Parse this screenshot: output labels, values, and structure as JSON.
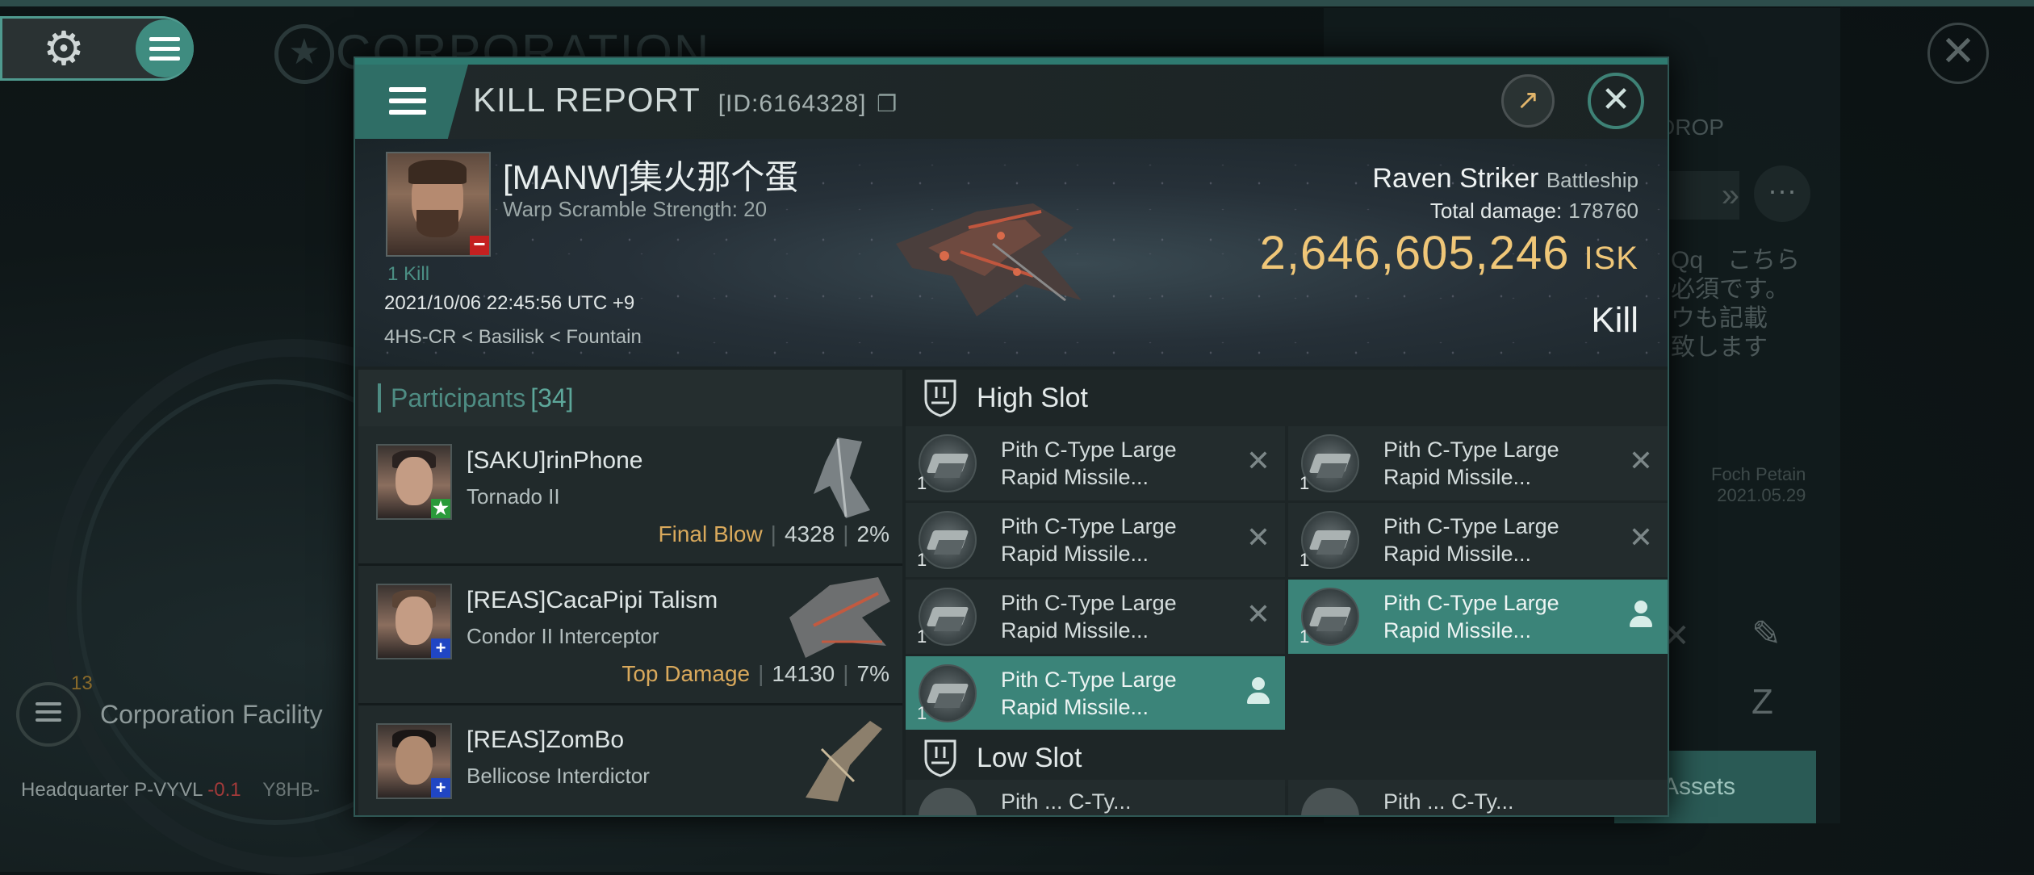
{
  "background": {
    "corp_title": "CORPORATION",
    "corp_facility_label": "Corporation Facility",
    "corp_facility_badge": "13",
    "hq_label": "Headquarter P-VYVL",
    "hq_sec": "-0.1",
    "hq_next": "Y8HB-",
    "assets_label": "Assets",
    "drop_label": "DROP",
    "jp_text_lines": [
      "Qq　こちら",
      "必須です。",
      "ウも記載",
      "致します"
    ],
    "foch_name": "Foch Petain",
    "foch_date": "2021.05.29"
  },
  "modal": {
    "title": "KILL REPORT",
    "id": "[ID:6164328]",
    "copy_icon": "❐"
  },
  "victim": {
    "name": "[MANW]集火那个蛋",
    "detail": "Warp Scramble Strength: 20",
    "kill_count": "1 Kill",
    "datetime": "2021/10/06 22:45:56 UTC +9",
    "location": "4HS-CR < Basilisk < Fountain"
  },
  "ship": {
    "name": "Raven Striker",
    "class": "Battleship",
    "total_damage_label": "Total damage:",
    "total_damage_value": "178760",
    "isk_value": "2,646,605,246",
    "isk_unit": "ISK",
    "result": "Kill"
  },
  "participants": {
    "label": "Participants",
    "count": "[34]",
    "rows": [
      {
        "name": "[SAKU]rinPhone",
        "ship": "Tornado II",
        "tag": "Final Blow",
        "damage": "4328",
        "pct": "2%",
        "badge": "★",
        "badge_color": "#2a9a3a"
      },
      {
        "name": "[REAS]CacaPipi Talism",
        "ship": "Condor II Interceptor",
        "tag": "Top Damage",
        "damage": "14130",
        "pct": "7%",
        "badge": "+",
        "badge_color": "#2046c4"
      },
      {
        "name": "[REAS]ZomBo",
        "ship": "Bellicose Interdictor",
        "tag": "",
        "damage": "",
        "pct": "",
        "badge": "+",
        "badge_color": "#2046c4"
      }
    ]
  },
  "high_slot": {
    "label": "High Slot",
    "modules": [
      {
        "line1": "Pith C-Type Large",
        "line2": "Rapid Missile...",
        "qty": "1",
        "state": "destroyed"
      },
      {
        "line1": "Pith C-Type Large",
        "line2": "Rapid Missile...",
        "qty": "1",
        "state": "destroyed"
      },
      {
        "line1": "Pith C-Type Large",
        "line2": "Rapid Missile...",
        "qty": "1",
        "state": "destroyed"
      },
      {
        "line1": "Pith C-Type Large",
        "line2": "Rapid Missile...",
        "qty": "1",
        "state": "destroyed"
      },
      {
        "line1": "Pith C-Type Large",
        "line2": "Rapid Missile...",
        "qty": "1",
        "state": "destroyed"
      },
      {
        "line1": "Pith C-Type Large",
        "line2": "Rapid Missile...",
        "qty": "1",
        "state": "dropped"
      },
      {
        "line1": "Pith C-Type Large",
        "line2": "Rapid Missile...",
        "qty": "1",
        "state": "dropped"
      }
    ]
  },
  "low_slot": {
    "label": "Low Slot",
    "peek": [
      "Pith ... C-Ty...",
      "Pith ... C-Ty..."
    ]
  },
  "icons": {
    "settings": "gear-icon",
    "menu": "hamburger-icon",
    "external": "external-link-icon",
    "close": "close-icon",
    "destroyed": "x-icon",
    "dropped": "person-icon"
  },
  "colors": {
    "accent": "#3b8479",
    "isk": "#f0c778",
    "tag": "#d9a95c",
    "kill_minus": "#c42020"
  }
}
